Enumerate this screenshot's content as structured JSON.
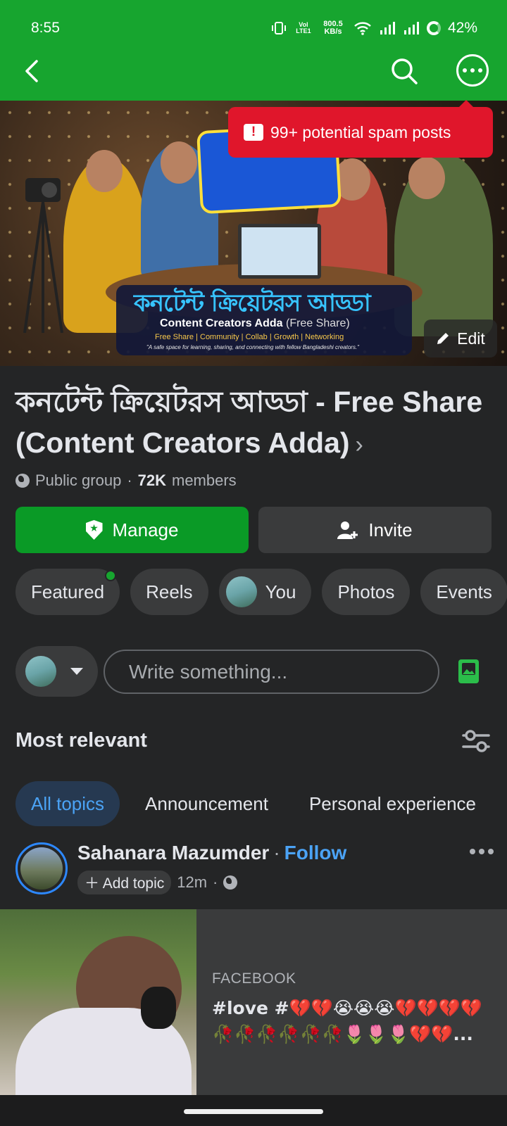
{
  "status_bar": {
    "time": "8:55",
    "volte": "Vol LTE1",
    "speed": "800.5 KB/s",
    "battery": "42%"
  },
  "nav": {
    "back_icon": "back-arrow-icon",
    "search_icon": "search-icon",
    "more_icon": "more-options-icon"
  },
  "spam_banner": "99+ potential spam posts",
  "cover": {
    "big_text": "কনটেন্ট ক্রিয়েটরস আড্ডা",
    "subtitle_main": "Content Creators Adda",
    "subtitle_paren": "(Free Share)",
    "tags": "Free Share | Community | Collab | Growth | Networking",
    "tagline": "\"A safe space for learning, sharing, and connecting with fellow Bangladeshi creators.\"",
    "edit_label": "Edit"
  },
  "group": {
    "title": "কনটেন্ট ক্রিয়েটরস আড্ডা - Free Share (Content Creators Adda)",
    "privacy": "Public group",
    "members_count": "72K",
    "members_label": "members"
  },
  "actions": {
    "manage": "Manage",
    "invite": "Invite"
  },
  "tabs": [
    {
      "label": "Featured"
    },
    {
      "label": "Reels"
    },
    {
      "label": "You"
    },
    {
      "label": "Photos"
    },
    {
      "label": "Events"
    }
  ],
  "composer": {
    "placeholder": "Write something..."
  },
  "feed": {
    "sort_label": "Most relevant",
    "topics": [
      "All topics",
      "Announcement",
      "Personal experience"
    ]
  },
  "post": {
    "author": "Sahanara Mazumder",
    "follow": "Follow",
    "add_topic": "Add topic",
    "time": "12m",
    "link_source": "FACEBOOK",
    "link_title": "#love #💔💔😭😭😭💔💔💔💔🥀🥀🥀🥀🥀🥀🌷🌷🌷💔💔..."
  },
  "colors": {
    "header_green": "#17a52f",
    "manage_green": "#0a9a26",
    "spam_red": "#e0162b",
    "link_blue": "#4ba3f5",
    "background": "#242526"
  }
}
